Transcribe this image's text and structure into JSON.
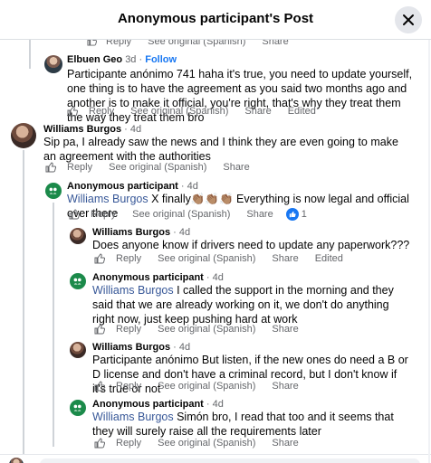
{
  "header": {
    "title": "Anonymous participant's Post"
  },
  "top_actions": [
    "Reply",
    "See original (Spanish)",
    "Share"
  ],
  "comments": [
    {
      "author": "Elbuen Geo",
      "time": "3d",
      "sep": "·",
      "follow": "Follow",
      "text": "Participante anónimo 741 haha it's true, you need to update yourself, one thing is to have the agreement as you said two months ago and another is to make it official, you're right, that's why they treat them the way they treat them bro",
      "actions": [
        "Reply",
        "See original (Spanish)",
        "Share",
        "Edited"
      ]
    },
    {
      "author": "Williams Burgos",
      "time": "· 4d",
      "text": "Sip pa, I already saw the news and I think they are even going to make an agreement with the authorities",
      "actions": [
        "Reply",
        "See original (Spanish)",
        "Share"
      ]
    },
    {
      "author": "Anonymous participant",
      "time": "· 4d",
      "mention": "Williams Burgos",
      "text": " X finally👏🏽👏🏽👏🏽 Everything is now legal and official over there",
      "actions": [
        "Reply",
        "See original (Spanish)",
        "Share"
      ],
      "reaction_count": "1"
    },
    {
      "author": "Williams Burgos",
      "time": "· 4d",
      "text": "Does anyone know if drivers need to update any paperwork???",
      "actions": [
        "Reply",
        "See original (Spanish)",
        "Share",
        "Edited"
      ]
    },
    {
      "author": "Anonymous participant",
      "time": "· 4d",
      "mention": "Williams Burgos",
      "text": " I called the support in the morning and they said that we are already working on it, we don't do anything right now, just keep pushing hard at work",
      "actions": [
        "Reply",
        "See original (Spanish)",
        "Share"
      ]
    },
    {
      "author": "Williams Burgos",
      "time": "· 4d",
      "text": "Participante anónimo But listen, if the new ones do need a B or D license and don't have a criminal record, but I don't know if it's true or not",
      "actions": [
        "Reply",
        "See original (Spanish)",
        "Share"
      ]
    },
    {
      "author": "Anonymous participant",
      "time": "· 4d",
      "mention": "Williams Burgos",
      "text": " Simón bro, I read that too and it seems that they will surely raise all the requirements later",
      "actions": [
        "Reply",
        "See original (Spanish)",
        "Share"
      ]
    }
  ]
}
